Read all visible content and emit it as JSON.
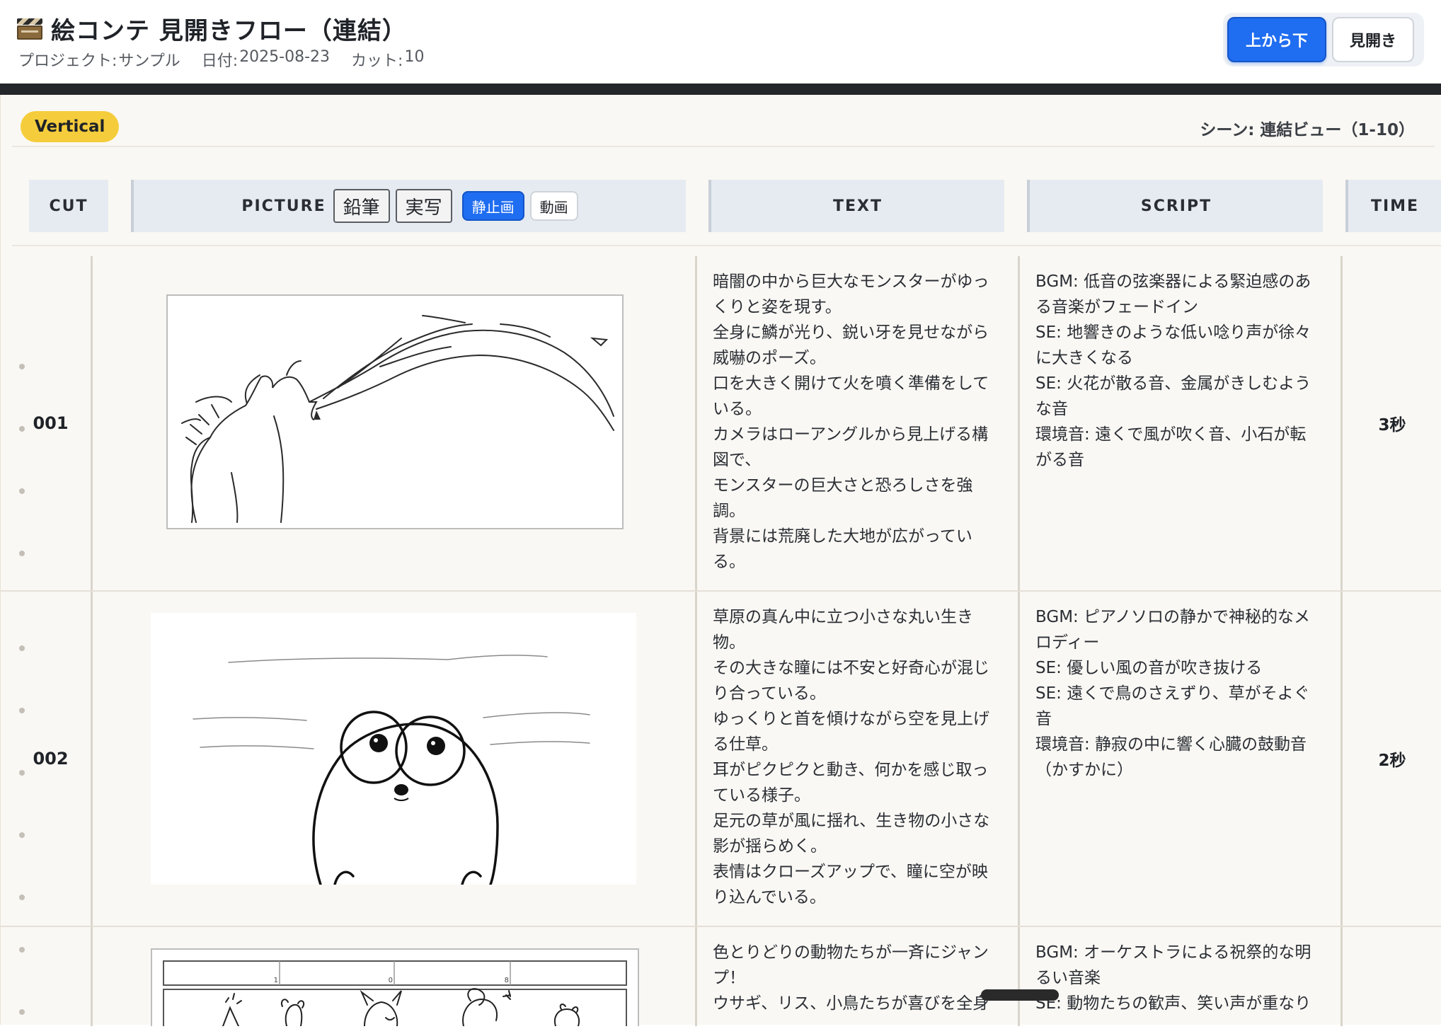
{
  "header": {
    "title": "絵コンテ 見開きフロー（連結）",
    "meta": {
      "project_label": "プロジェクト:",
      "project_value": "サンプル",
      "date_label": "日付:",
      "date_value": "2025-08-23",
      "cuts_label": "カット:",
      "cuts_value": "10"
    },
    "view_buttons": {
      "top_to_bottom": "上から下",
      "spread": "見開き"
    }
  },
  "board": {
    "orientation_tag": "Vertical",
    "scene_label": "シーン: 連結ビュー（1-10）",
    "columns": {
      "cut": "CUT",
      "picture": "PICTURE",
      "text": "TEXT",
      "script": "SCRIPT",
      "time": "TIME"
    },
    "picture_modes": {
      "pencil": "鉛筆",
      "photo": "実写",
      "still": "静止画",
      "video": "動画"
    }
  },
  "cuts": [
    {
      "number": "001",
      "image": "monster-breathing-fire-sketch",
      "text": [
        "暗闇の中から巨大なモンスターがゆっ",
        "くりと姿を現す。",
        "全身に鱗が光り、鋭い牙を見せながら",
        "威嚇のポーズ。",
        "口を大きく開けて火を噴く準備をして",
        "いる。",
        "カメラはローアングルから見上げる構",
        "図で、",
        "モンスターの巨大さと恐ろしさを強",
        "調。",
        "背景には荒廃した大地が広がってい",
        "る。"
      ],
      "script": [
        "BGM: 低音の弦楽器による緊迫感のあ",
        "る音楽がフェードイン",
        "SE: 地響きのような低い唸り声が徐々",
        "に大きくなる",
        "SE: 火花が散る音、金属がきしむよう",
        "な音",
        "環境音: 遠くで風が吹く音、小石が転",
        "がる音"
      ],
      "time": "3秒"
    },
    {
      "number": "002",
      "image": "small-round-creature-sketch",
      "text": [
        "草原の真ん中に立つ小さな丸い生き",
        "物。",
        "その大きな瞳には不安と好奇心が混じ",
        "り合っている。",
        "ゆっくりと首を傾けながら空を見上げ",
        "る仕草。",
        "耳がピクピクと動き、何かを感じ取っ",
        "ている様子。",
        "足元の草が風に揺れ、生き物の小さな",
        "影が揺らめく。",
        "表情はクローズアップで、瞳に空が映",
        "り込んでいる。"
      ],
      "script": [
        "BGM: ピアノソロの静かで神秘的なメ",
        "ロディー",
        "SE: 優しい風の音が吹き抜ける",
        "SE: 遠くで鳥のさえずり、草がそよぐ",
        "音",
        "環境音: 静寂の中に響く心臓の鼓動音",
        "（かすかに）"
      ],
      "time": "2秒"
    },
    {
      "number": "",
      "image": "animals-jumping-celebration-sketch",
      "text": [
        "色とりどりの動物たちが一斉にジャン",
        "プ！",
        "ウサギ、リス、小鳥たちが喜びを全身"
      ],
      "script": [
        "BGM: オーケストラによる祝祭的な明",
        "るい音楽",
        "SE: 動物たちの歓声、笑い声が重なり"
      ],
      "sketch_ruler": [
        "1",
        "0",
        "8"
      ],
      "time": ""
    }
  ]
}
